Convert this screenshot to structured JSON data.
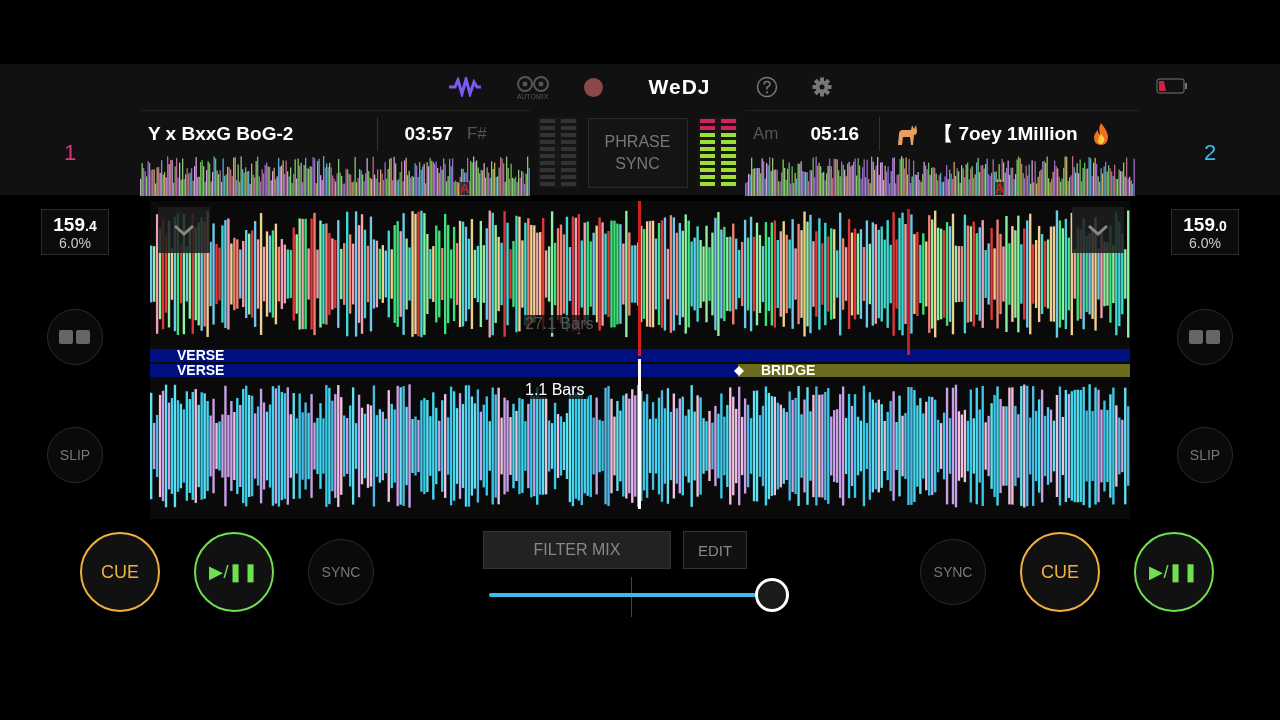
{
  "header": {
    "logo": "WeDJ",
    "automix_label": "AUTOMIX",
    "recording": false
  },
  "decks": [
    {
      "number": "1",
      "title": "Y x BxxG BoG-2",
      "time": "03:57",
      "key": "F#",
      "bpm_whole": "159",
      "bpm_decimal": ".4",
      "pitch": "6.0%",
      "meter": {
        "level": 0
      },
      "phrase": "VERSE",
      "bars": "27.1 Bars",
      "slip": "SLIP",
      "cue": "CUE",
      "play": "▶/❚❚",
      "sync": "SYNC",
      "cue_marker": "A"
    },
    {
      "number": "2",
      "title": "【 7oey 1Million",
      "time": "05:16",
      "key": "Am",
      "bpm_whole": "159",
      "bpm_decimal": ".0",
      "pitch": "6.0%",
      "meter": {
        "level": 1
      },
      "phrase": "VERSE",
      "next_phrase": "BRIDGE",
      "bars": "1.1 Bars",
      "slip": "SLIP",
      "cue": "CUE",
      "play": "▶/❚❚",
      "sync": "SYNC",
      "cue_marker": "A"
    }
  ],
  "phrase_sync": "PHRASE SYNC",
  "mixer": {
    "effect": "FILTER MIX",
    "edit": "EDIT",
    "crossfader": {
      "level": 1
    }
  }
}
